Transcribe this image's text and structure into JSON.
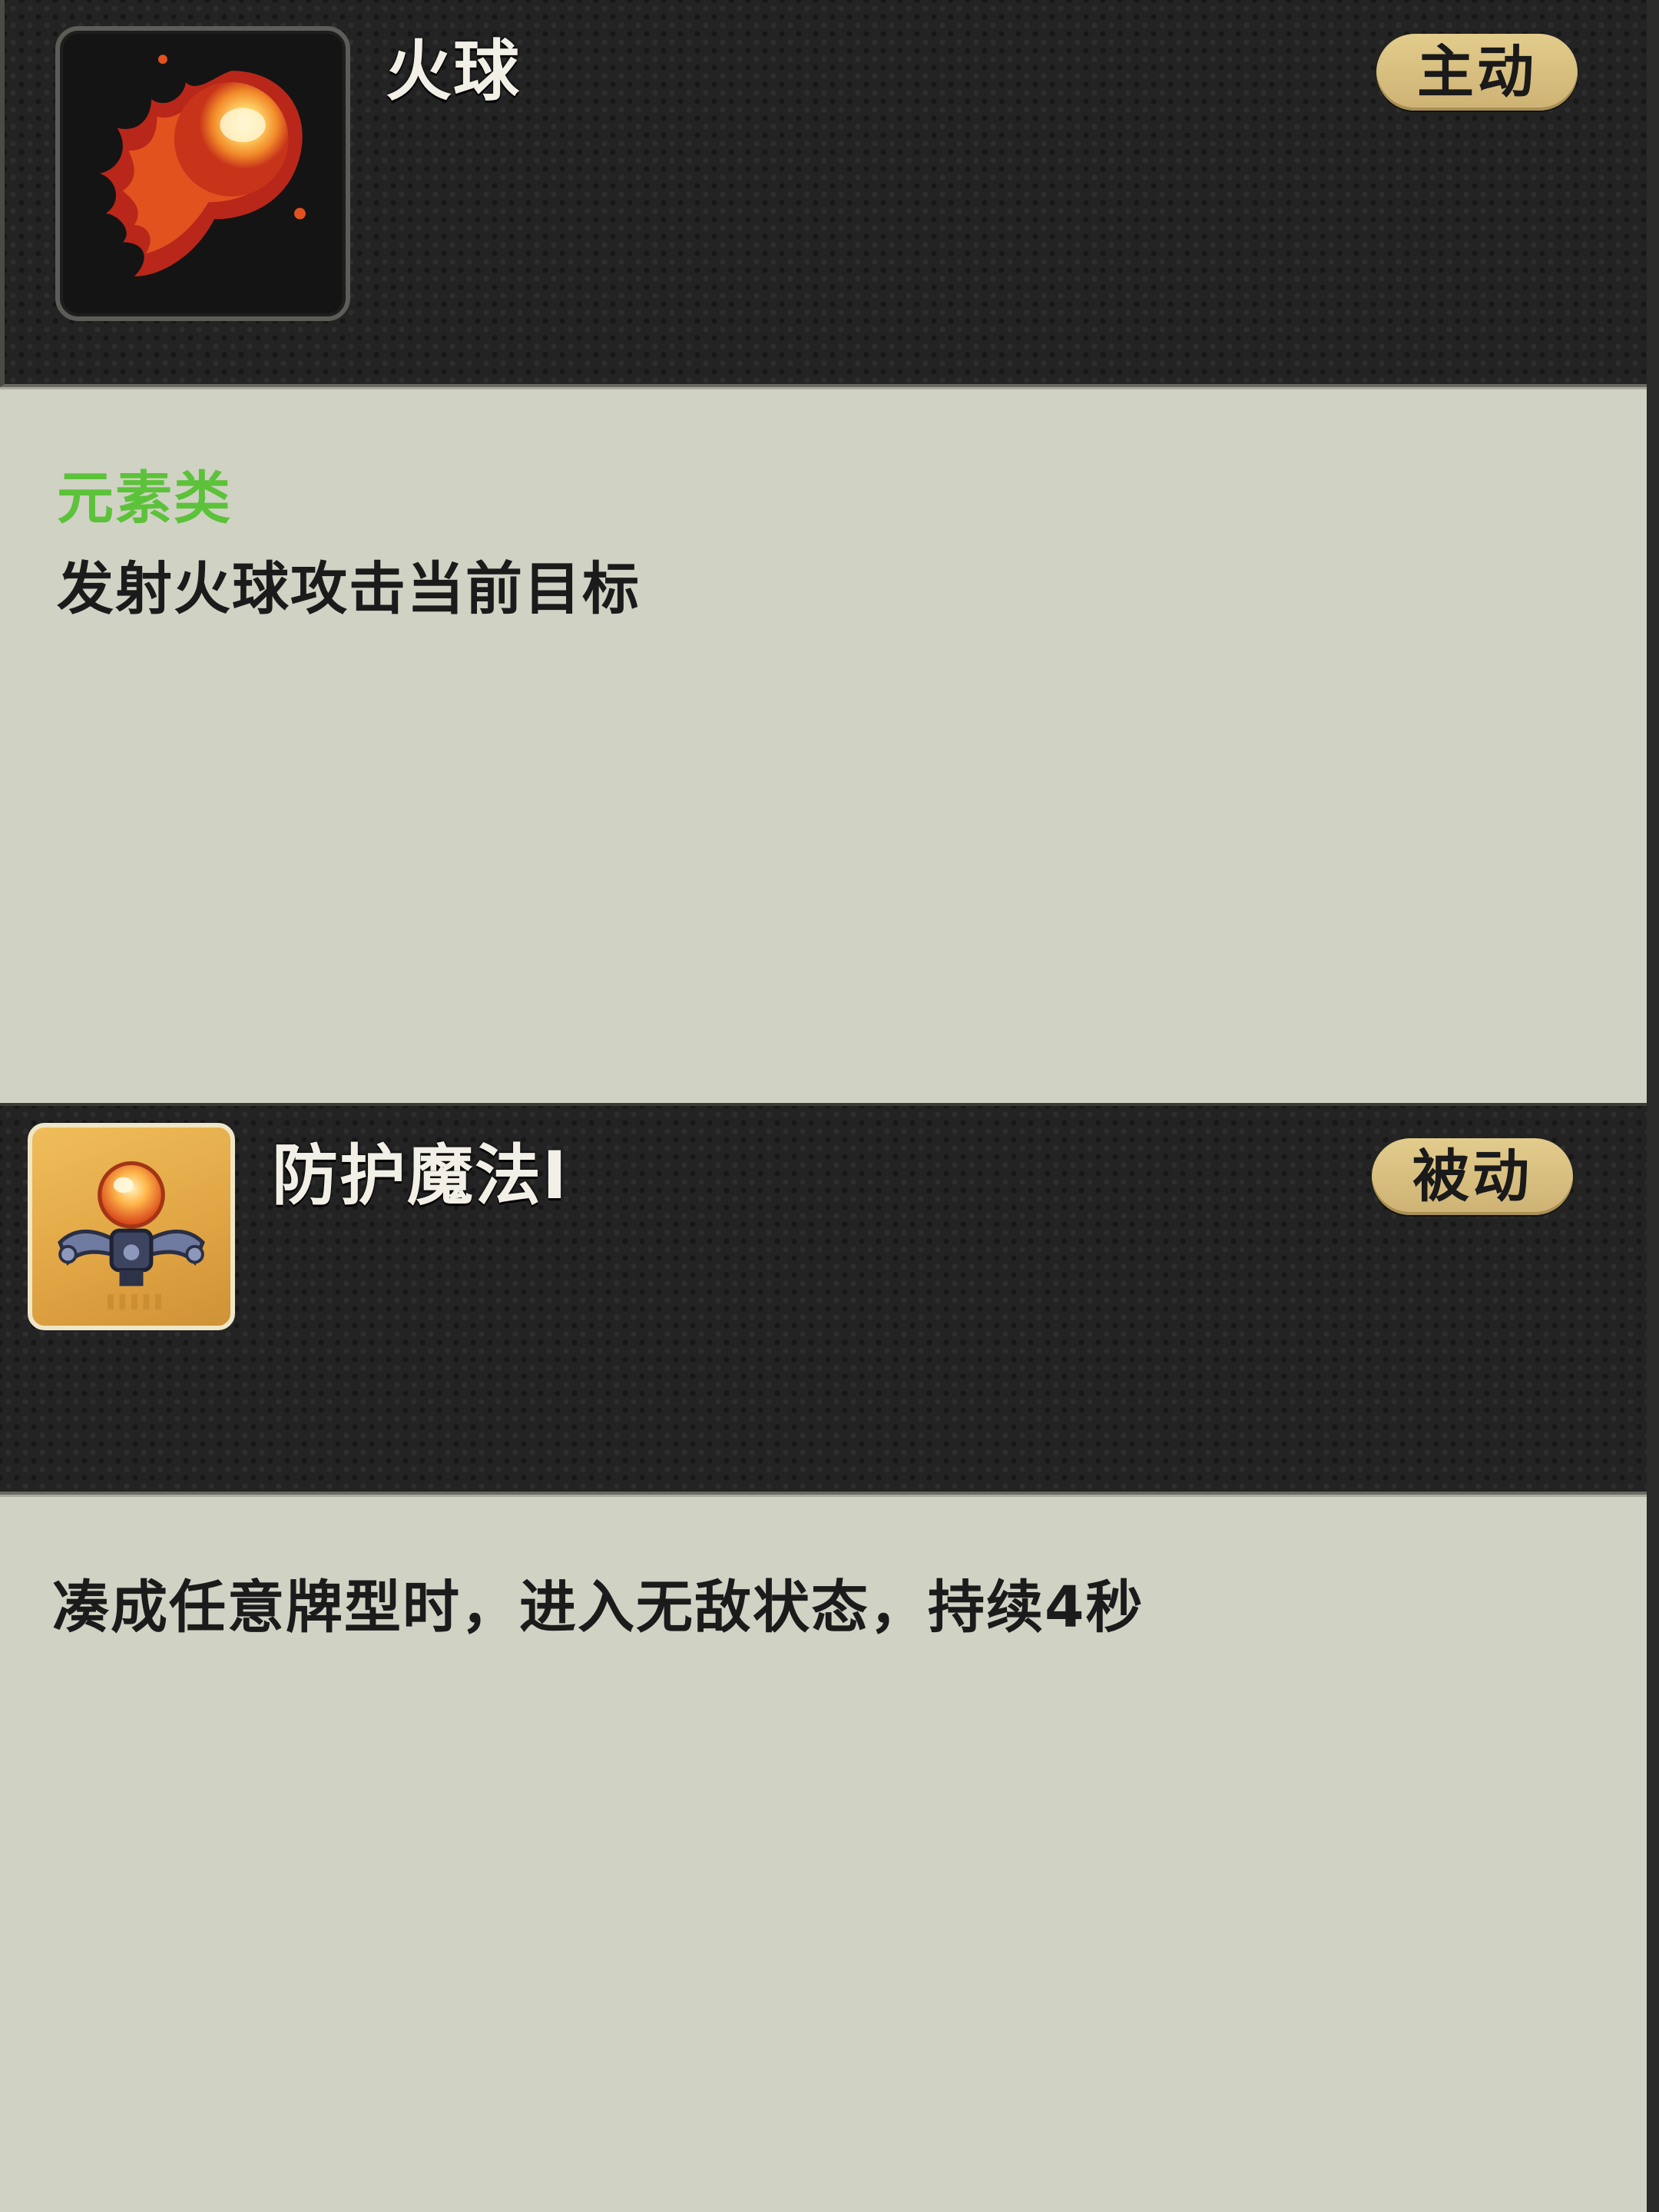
{
  "skills": [
    {
      "name": "火球",
      "tag": "主动",
      "category": "元素类",
      "description": "发射火球攻击当前目标",
      "icon": "fireball-icon",
      "colors": {
        "category": "#5cc23a",
        "tag_bg": "#d6bd7e",
        "header": "#232323"
      }
    },
    {
      "name": "防护魔法I",
      "tag": "被动",
      "description": "凑成任意牌型时，进入无敌状态，持续4秒",
      "icon": "shield-orb-icon",
      "colors": {
        "icon_bg": "#e6aa48",
        "tag_bg": "#d6bd7e",
        "header": "#232323"
      }
    }
  ]
}
